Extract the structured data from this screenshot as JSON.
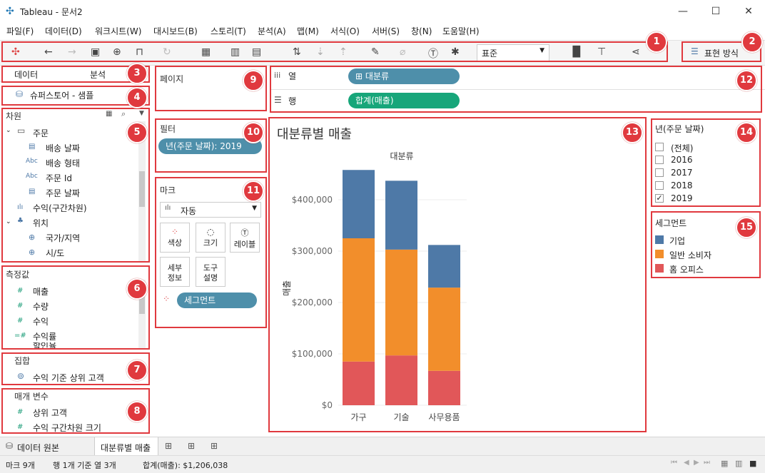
{
  "window": {
    "title": "Tableau - 문서2",
    "minimize": "—",
    "maximize": "☐",
    "close": "✕"
  },
  "menu": [
    "파일(F)",
    "데이터(D)",
    "워크시트(W)",
    "대시보드(B)",
    "스토리(T)",
    "분석(A)",
    "맵(M)",
    "서식(O)",
    "서버(S)",
    "창(N)",
    "도움말(H)"
  ],
  "toolbar": {
    "fit_select": "표준",
    "show_me": "표현 방식"
  },
  "badges": [
    "1",
    "2",
    "3",
    "4",
    "5",
    "6",
    "7",
    "8",
    "9",
    "10",
    "11",
    "12",
    "13",
    "14",
    "15"
  ],
  "left_tabs": {
    "data": "데이터",
    "analysis": "분석"
  },
  "datasource": "슈퍼스토어 - 샘플",
  "dimensions": {
    "title": "차원",
    "items": [
      {
        "label": "주문",
        "icon": "folder-icon"
      },
      {
        "label": "배송 날짜",
        "icon": "calendar-icon"
      },
      {
        "label": "배송 형태",
        "icon": "abc-icon",
        "icon_text": "Abc"
      },
      {
        "label": "주문 Id",
        "icon": "abc-icon",
        "icon_text": "Abc"
      },
      {
        "label": "주문 날짜",
        "icon": "calendar-icon"
      },
      {
        "label": "수익(구간차원)",
        "icon": "bin-icon"
      },
      {
        "label": "위치",
        "icon": "hierarchy-icon"
      },
      {
        "label": "국가/지역",
        "icon": "globe-icon"
      },
      {
        "label": "시/도",
        "icon": "globe-icon"
      }
    ]
  },
  "measures": {
    "title": "측정값",
    "items": [
      "매출",
      "수량",
      "수익",
      "수익률",
      "할인율"
    ]
  },
  "sets": {
    "title": "집합",
    "items": [
      "수익 기준 상위 고객"
    ]
  },
  "parameters": {
    "title": "매개 변수",
    "items": [
      "상위 고객",
      "수익 구간차원 크기"
    ]
  },
  "pages": {
    "title": "페이지"
  },
  "filters": {
    "title": "필터",
    "pill": "년(주문 날짜): 2019"
  },
  "marks": {
    "title": "마크",
    "type": "자동",
    "buttons": [
      {
        "label": "색상",
        "icon": "color-icon"
      },
      {
        "label": "크기",
        "icon": "size-icon"
      },
      {
        "label": "레이블",
        "icon": "label-icon"
      },
      {
        "label": "세부\n정보",
        "icon": "detail-icon"
      },
      {
        "label": "도구\n설명",
        "icon": "tooltip-icon"
      }
    ],
    "color_pill": "세그먼트"
  },
  "shelves": {
    "columns_label": "열",
    "rows_label": "행",
    "columns_pill": "⊞ 대분류",
    "rows_pill": "합계(매출)"
  },
  "chart_data": {
    "type": "bar",
    "stacked": true,
    "title": "대분류별 매출",
    "header": "대분류",
    "ylabel": "매출",
    "categories": [
      "가구",
      "기술",
      "사무용품"
    ],
    "ylim": [
      0,
      450000
    ],
    "yticks": [
      "$0",
      "$100,000",
      "$200,000",
      "$300,000",
      "$400,000"
    ],
    "ytick_values": [
      0,
      100000,
      200000,
      300000,
      400000
    ],
    "series": [
      {
        "name": "홈 오피스",
        "color": "#e15759",
        "values": [
          85000,
          97000,
          67000
        ]
      },
      {
        "name": "일반 소비자",
        "color": "#f28e2b",
        "values": [
          240000,
          206000,
          162000
        ]
      },
      {
        "name": "기업",
        "color": "#4e79a7",
        "values": [
          133000,
          134000,
          83000
        ]
      }
    ]
  },
  "year_filter": {
    "title": "년(주문 날짜)",
    "options": [
      {
        "label": "(전체)",
        "checked": false
      },
      {
        "label": "2016",
        "checked": false
      },
      {
        "label": "2017",
        "checked": false
      },
      {
        "label": "2018",
        "checked": false
      },
      {
        "label": "2019",
        "checked": true
      }
    ]
  },
  "legend": {
    "title": "세그먼트",
    "items": [
      {
        "label": "기업",
        "color": "#4e79a7"
      },
      {
        "label": "일반 소비자",
        "color": "#f28e2b"
      },
      {
        "label": "홈 오피스",
        "color": "#e15759"
      }
    ]
  },
  "sheet_tabs": {
    "datasource": "데이터 원본",
    "active": "대분류별 매출"
  },
  "status": {
    "marks": "마크 9개",
    "rows_cols": "행 1개 기준 열 3개",
    "sum": "합계(매출): $1,206,038"
  }
}
